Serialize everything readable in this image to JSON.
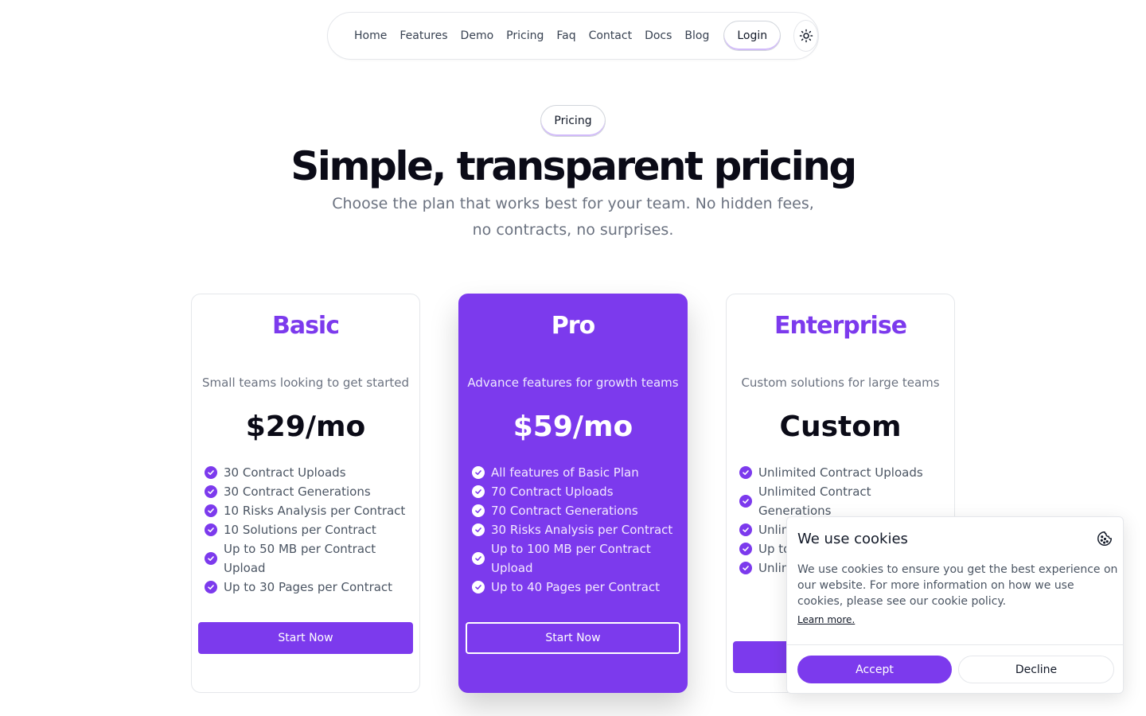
{
  "nav": {
    "links": [
      "Home",
      "Features",
      "Demo",
      "Pricing",
      "Faq",
      "Contact",
      "Docs",
      "Blog"
    ],
    "login_label": "Login",
    "theme_icon": "sun-icon"
  },
  "hero": {
    "badge": "Pricing",
    "title": "Simple, transparent pricing",
    "subtitle": "Choose the plan that works best for your team. No hidden fees, no contracts, no surprises."
  },
  "plans": [
    {
      "name": "Basic",
      "description": "Small teams looking to get started",
      "price": "$29/mo",
      "features": [
        "30 Contract Uploads",
        "30 Contract Generations",
        "10 Risks Analysis per Contract",
        "10 Solutions per Contract",
        "Up to 50 MB per Contract Upload",
        "Up to 30 Pages per Contract"
      ],
      "cta": "Start Now"
    },
    {
      "name": "Pro",
      "description": "Advance features for growth teams",
      "price": "$59/mo",
      "features": [
        "All features of Basic Plan",
        "70 Contract Uploads",
        "70 Contract Generations",
        "30 Risks Analysis per Contract",
        "Up to 100 MB per Contract Upload",
        "Up to 40 Pages per Contract"
      ],
      "cta": "Start Now"
    },
    {
      "name": "Enterprise",
      "description": "Custom solutions for large teams",
      "price": "Custom",
      "features": [
        "Unlimited Contract Uploads",
        "Unlimited Contract Generations",
        "Unlim Contr",
        "Up to Uplo",
        "Unlim"
      ],
      "cta": ""
    }
  ],
  "cookie": {
    "title": "We use cookies",
    "icon": "cookie-icon",
    "text": "We use cookies to ensure you get the best experience on our website. For more information on how we use cookies, please see our cookie policy.",
    "link": "Learn more.",
    "accept": "Accept",
    "decline": "Decline"
  },
  "colors": {
    "accent": "#7c3aed",
    "text": "#0b0b17",
    "muted": "#6b7280"
  }
}
